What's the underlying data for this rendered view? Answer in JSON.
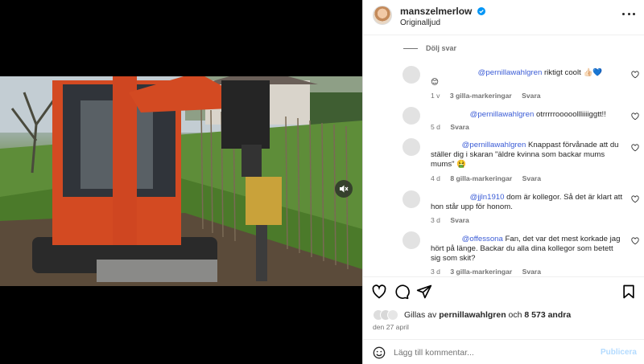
{
  "post": {
    "author": "manszelmerlow",
    "audio": "Originalljud"
  },
  "replies_toggle": "Dölj svar",
  "comments": [
    {
      "mention": "@pernillawahlgren",
      "text": " riktigt coolt 👍🏻💙",
      "text2": "😊",
      "age": "1 v",
      "likes": "3 gilla-markeringar",
      "reply": "Svara"
    },
    {
      "mention": "@pernillawahlgren",
      "text": " otrrrrrooooollliiiiggtt!!",
      "age": "5 d",
      "likes": "",
      "reply": "Svara"
    },
    {
      "mention": "@pernillawahlgren",
      "text": " Knappast förvånade att du ställer dig i skaran \"äldre kvinna som backar mums mums\" 🤮",
      "age": "4 d",
      "likes": "8 gilla-markeringar",
      "reply": "Svara"
    },
    {
      "mention": "@jjln1910",
      "text": " dom är kollegor. Så det är klart att hon står upp för honom.",
      "age": "3 d",
      "likes": "",
      "reply": "Svara"
    },
    {
      "mention": "@offessona",
      "text": " Fan, det var det mest korkade jag hört på länge. Backar du alla dina kollegor som betett sig som skit?",
      "age": "3 d",
      "likes": "3 gilla-markeringar",
      "reply": "Svara"
    }
  ],
  "likes": {
    "prefix": "Gillas av ",
    "user": "pernillawahlgren",
    "mid": " och ",
    "count": "8 573 andra"
  },
  "date": "den 27 april",
  "comment_box": {
    "placeholder": "Lägg till kommentar...",
    "publish": "Publicera"
  },
  "colors": {
    "mention": "#3b5cd6",
    "publish_disabled": "#b3dbff",
    "verified": "#0095f6"
  }
}
